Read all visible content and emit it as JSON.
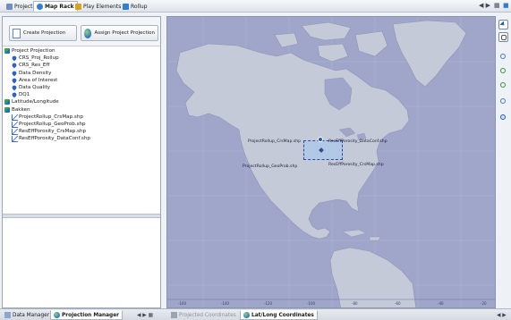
{
  "top_tabs": [
    {
      "label": "Project",
      "color": "#6e8fbf"
    },
    {
      "label": "Map Rack",
      "color": "#2f7fd0"
    },
    {
      "label": "Play Elements",
      "color": "#d9a21b"
    },
    {
      "label": "Rollup",
      "color": "#2f7fd0"
    }
  ],
  "top_controls": {
    "prev": "◀",
    "next": "▶",
    "menu": "▦"
  },
  "buttons": {
    "create_projection": "Create Projection",
    "assign_projection": "Assign Project Projection"
  },
  "tree": [
    {
      "label": "Project Projection",
      "level": 0,
      "icon": "layer-group-icon"
    },
    {
      "label": "CRS_Proj_Rollup",
      "level": 1,
      "icon": "pin-icon"
    },
    {
      "label": "CRS_Res_Eff",
      "level": 1,
      "icon": "pin-icon"
    },
    {
      "label": "Data Density",
      "level": 1,
      "icon": "pin-icon"
    },
    {
      "label": "Area of Interest",
      "level": 1,
      "icon": "pin-icon"
    },
    {
      "label": "Data Quality",
      "level": 1,
      "icon": "pin-icon"
    },
    {
      "label": "DQ1",
      "level": 1,
      "icon": "pin-icon"
    },
    {
      "label": "Latitude/Longitude",
      "level": 0,
      "icon": "layer-group-icon"
    },
    {
      "label": "Bakken",
      "level": 0,
      "icon": "layer-group-icon"
    },
    {
      "label": "ProjectRollup_CrsMap.shp",
      "level": 1,
      "icon": "shapefile-icon"
    },
    {
      "label": "ProjectRollup_GeoProb.shp",
      "level": 1,
      "icon": "shapefile-icon"
    },
    {
      "label": "ResEffPorosity_CrsMap.shp",
      "level": 1,
      "icon": "shapefile-icon"
    },
    {
      "label": "ResEffPorosity_DataConf.shp",
      "level": 1,
      "icon": "shapefile-icon"
    }
  ],
  "bottom_tabs": [
    {
      "label": "Data Manager",
      "active": false,
      "dim": false
    },
    {
      "label": "Projection Manager",
      "active": true,
      "dim": false
    },
    {
      "label": "Projected Coordinates",
      "active": false,
      "dim": true
    },
    {
      "label": "Lat/Long Coordinates",
      "active": true,
      "dim": false
    }
  ],
  "bottom_controls": {
    "left_nav": "◀ ▶ ▦",
    "right_nav": "◀ ▶"
  },
  "map": {
    "ocean_color": "#9fa6c9",
    "land_color": "#c5cad9",
    "labels": {
      "top_left": "ProjectRollup_CrsMap.shp",
      "top_right": "ResEffPorosity_DataConf.shp",
      "bottom_left": "ProjectRollup_GeoProb.shp",
      "bottom_right": "ResEffPorosity_CrsMap.shp"
    },
    "x_ticks": [
      "-160",
      "-140",
      "-120",
      "-100",
      "-80",
      "-60",
      "-40",
      "-20"
    ]
  },
  "tools": [
    "select-arrow-icon",
    "pan-hand-icon",
    "zoom-in-icon",
    "zoom-extent-icon",
    "zoom-prev-icon",
    "zoom-next-icon",
    "identify-icon"
  ]
}
